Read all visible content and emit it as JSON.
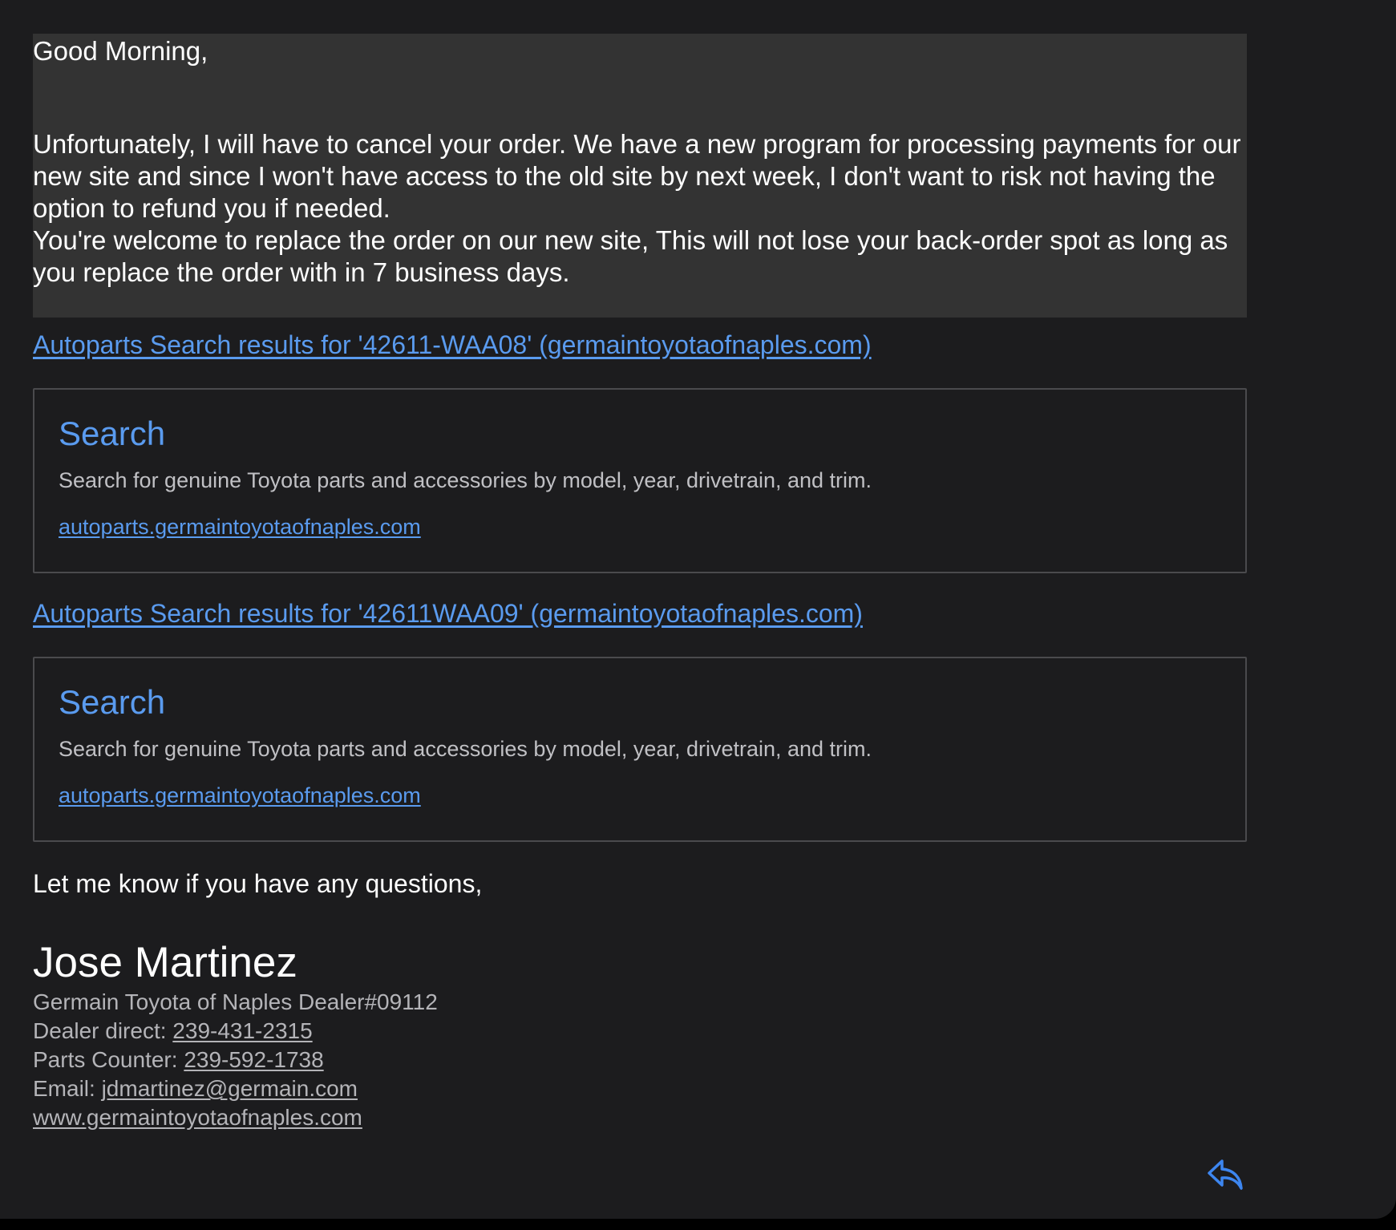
{
  "message": {
    "greeting": "Good Morning,",
    "paragraph1": "Unfortunately, I will have to cancel your order. We have a new program for processing payments for our new site and since I won't have access to the old site by next week, I don't want to risk not having the option to refund you if needed.",
    "paragraph2": "You're welcome to replace the order on our new site, This will not lose your back-order spot as long as you replace the order with in 7 business days."
  },
  "links": [
    {
      "text": "Autoparts Search results for '42611-WAA08' (germaintoyotaofnaples.com)",
      "preview": {
        "title": "Search",
        "description": "Search for genuine Toyota parts and accessories by model, year, drivetrain, and trim.",
        "url": "autoparts.germaintoyotaofnaples.com"
      }
    },
    {
      "text": "Autoparts Search results for '42611WAA09' (germaintoyotaofnaples.com)",
      "preview": {
        "title": "Search",
        "description": "Search for genuine Toyota parts and accessories by model, year, drivetrain, and trim.",
        "url": "autoparts.germaintoyotaofnaples.com"
      }
    }
  ],
  "closing": "Let me know if you have any questions,",
  "signature": {
    "name": "Jose Martinez",
    "dealer": "Germain Toyota of Naples Dealer#09112",
    "dealer_direct_label": "Dealer direct: ",
    "dealer_direct_number": "239-431-2315",
    "parts_counter_label": "Parts Counter: ",
    "parts_counter_number": "239-592-1738",
    "email_label": "Email: ",
    "email": "jdmartinez@germain.com",
    "website": "www.germaintoyotaofnaples.com"
  },
  "icons": {
    "reply": "reply-arrow-icon"
  },
  "colors": {
    "background": "#1c1c1e",
    "quote_background": "#333333",
    "link": "#5a9bef",
    "text": "#ffffff",
    "secondary_text": "#b4b4b8"
  }
}
